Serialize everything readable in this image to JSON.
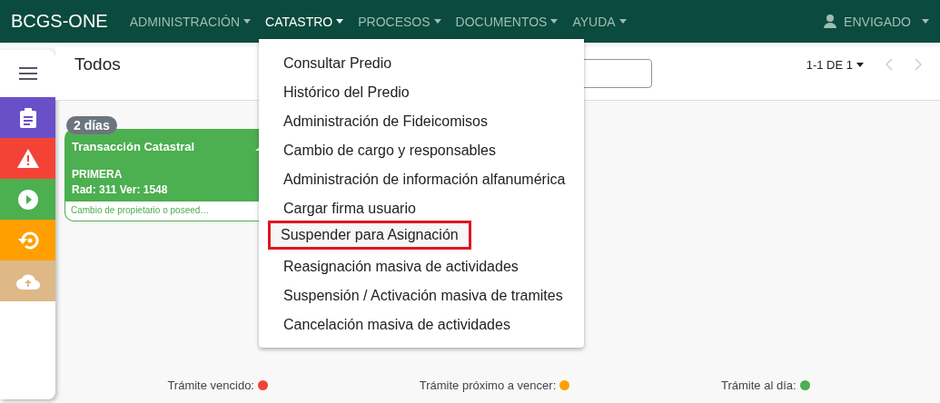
{
  "navbar": {
    "brand": "BCGS-ONE",
    "menus": [
      {
        "label": "ADMINISTRACIÓN",
        "selected": false
      },
      {
        "label": "CATASTRO",
        "selected": true
      },
      {
        "label": "PROCESOS",
        "selected": false
      },
      {
        "label": "DOCUMENTOS",
        "selected": false
      },
      {
        "label": "AYUDA",
        "selected": false
      }
    ],
    "user": "ENVIGADO"
  },
  "sidebar": {
    "items": [
      {
        "kind": "clipboard",
        "color": "#6a50c8"
      },
      {
        "kind": "warning",
        "color": "#f44336"
      },
      {
        "kind": "play",
        "color": "#4caf50"
      },
      {
        "kind": "history",
        "color": "#ffa000"
      },
      {
        "kind": "upload",
        "color": "#deb887"
      }
    ]
  },
  "header": {
    "title": "Todos",
    "pagination": "1-1 DE 1"
  },
  "cards": [
    {
      "badge": "2 días",
      "title": "Transacción Catastral",
      "line_1": "PRIMERA",
      "line_2": "Rad: 311 Ver: 1548",
      "footer": "Cambio de propietario o poseed…"
    }
  ],
  "dropdown": {
    "items": [
      {
        "label": "Consultar Predio",
        "selected": false
      },
      {
        "label": "Histórico del Predio",
        "selected": false
      },
      {
        "label": "Administración de Fideicomisos",
        "selected": false
      },
      {
        "label": "Cambio de cargo y responsables",
        "selected": false
      },
      {
        "label": "Administración de información alfanumérica",
        "selected": false
      },
      {
        "label": "Cargar firma usuario",
        "selected": false
      },
      {
        "label": "Suspender para Asignación",
        "selected": true
      },
      {
        "label": "Reasignación masiva de actividades",
        "selected": false
      },
      {
        "label": "Suspensión / Activación masiva de tramites",
        "selected": false
      },
      {
        "label": "Cancelación masiva de actividades",
        "selected": false
      }
    ]
  },
  "legend": [
    {
      "label": "Trámite vencido:",
      "color": "#f44336"
    },
    {
      "label": "Trámite próximo a vencer:",
      "color": "#ffa000"
    },
    {
      "label": "Trámite al día:",
      "color": "#4caf50"
    }
  ]
}
